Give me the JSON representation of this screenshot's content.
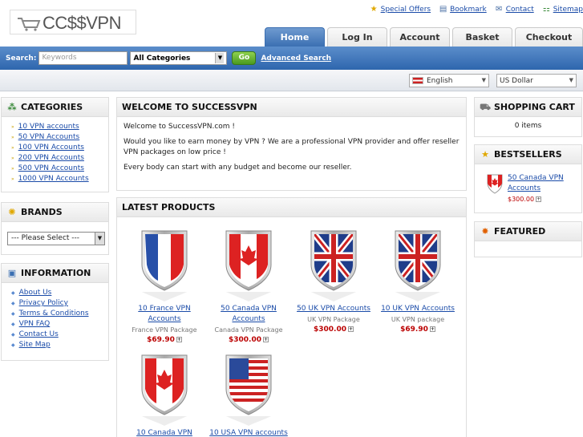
{
  "logo": {
    "text": "CC$$VPN"
  },
  "toplinks": [
    {
      "label": "Special Offers",
      "icon": "star-icon"
    },
    {
      "label": "Bookmark",
      "icon": "bookmark-icon"
    },
    {
      "label": "Contact",
      "icon": "envelope-icon"
    },
    {
      "label": "Sitemap",
      "icon": "sitemap-icon"
    }
  ],
  "tabs": [
    "Home",
    "Log In",
    "Account",
    "Basket",
    "Checkout"
  ],
  "search": {
    "label": "Search:",
    "placeholder": "Keywords",
    "category": "All Categories",
    "go": "Go",
    "advanced": "Advanced Search"
  },
  "lang": {
    "language": "English",
    "currency": "US Dollar"
  },
  "categories": {
    "title": "CATEGORIES",
    "items": [
      "10 VPN accounts",
      "50 VPN Accounts",
      "100 VPN Accounts",
      "200 VPN Accounts",
      "500 VPN Accounts",
      "1000 VPN Accounts"
    ]
  },
  "brands": {
    "title": "BRANDS",
    "select": "--- Please Select ---"
  },
  "information": {
    "title": "INFORMATION",
    "items": [
      "About Us",
      "Privacy Policy",
      "Terms & Conditions",
      "VPN FAQ",
      "Contact Us",
      "Site Map"
    ]
  },
  "welcome": {
    "title": "WELCOME TO SUCCESSVPN",
    "p1": "Welcome to SuccessVPN.com !",
    "p2": "Would you like to earn money by VPN ? We are a professional VPN provider and offer reseller VPN packages on low price !",
    "p3": "Every body can start with any budget and become our reseller."
  },
  "latest": {
    "title": "LATEST PRODUCTS",
    "products": [
      {
        "name": "10 France VPN Accounts",
        "desc": "France VPN Package",
        "price": "$69.90",
        "flag": "france"
      },
      {
        "name": "50 Canada VPN Accounts",
        "desc": "Canada VPN Package",
        "price": "$300.00",
        "flag": "canada"
      },
      {
        "name": "50 UK VPN Accounts",
        "desc": "UK VPN Package",
        "price": "$300.00",
        "flag": "uk"
      },
      {
        "name": "10 UK VPN Accounts",
        "desc": "UK VPN package",
        "price": "$69.90",
        "flag": "uk"
      },
      {
        "name": "10 Canada VPN",
        "desc": "",
        "price": "",
        "flag": "canada"
      },
      {
        "name": "10 USA VPN accounts",
        "desc": "",
        "price": "",
        "flag": "usa"
      }
    ]
  },
  "cart": {
    "title": "SHOPPING CART",
    "text": "0 items"
  },
  "bestsellers": {
    "title": "BESTSELLERS",
    "name": "50 Canada VPN Accounts",
    "price": "$300.00"
  },
  "featured": {
    "title": "FEATURED"
  },
  "colors": {
    "accent": "#3b6fb2",
    "price": "#bb0000",
    "link": "#1a4ba8"
  }
}
